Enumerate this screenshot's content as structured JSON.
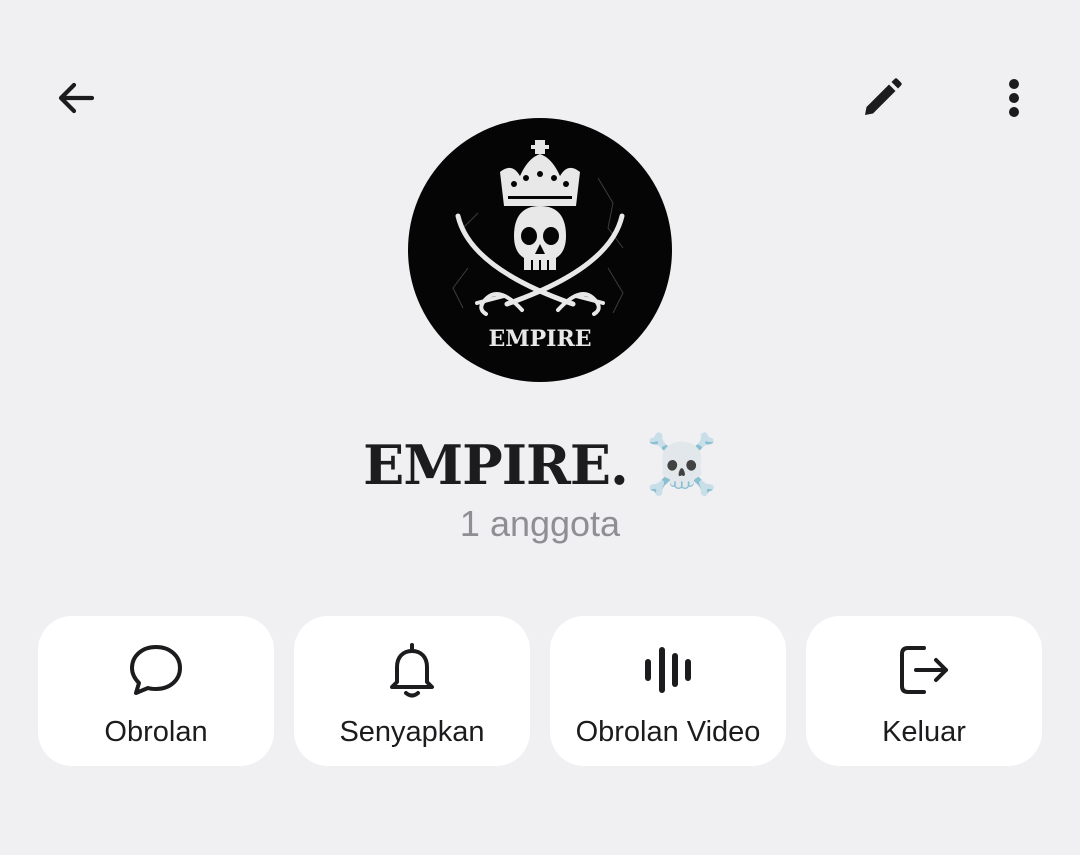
{
  "header": {
    "back_icon": "arrow-left-icon",
    "edit_icon": "pencil-icon",
    "more_icon": "more-vertical-icon"
  },
  "profile": {
    "avatar_text": "EMPIRE",
    "name": "EMPIRE.",
    "name_emoji": "☠️",
    "member_count": "1 anggota"
  },
  "actions": [
    {
      "label": "Obrolan",
      "icon": "chat-bubble-icon"
    },
    {
      "label": "Senyapkan",
      "icon": "bell-icon"
    },
    {
      "label": "Obrolan Video",
      "icon": "audio-bars-icon"
    },
    {
      "label": "Keluar",
      "icon": "logout-icon"
    }
  ],
  "colors": {
    "background": "#f0f0f2",
    "card": "#ffffff",
    "text": "#1c1c1e",
    "secondary_text": "#8e8e93"
  }
}
